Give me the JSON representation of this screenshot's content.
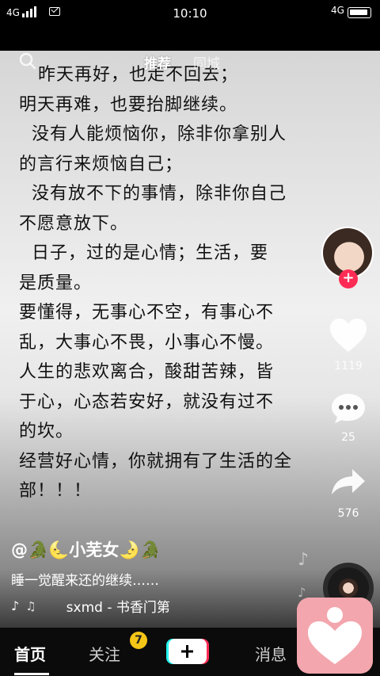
{
  "status": {
    "network_left": "4G",
    "time": "10:10",
    "network_right": "4G"
  },
  "top_tabs": {
    "recommend": "推荐",
    "local": "同城"
  },
  "post": {
    "lines": [
      "   昨天再好，也走不回去；",
      "明天再难，也要抬脚继续。",
      "  没有人能烦恼你，除非你拿别人",
      "的言行来烦恼自己；",
      "  没有放不下的事情，除非你自己",
      "不愿意放下。",
      "  日子，过的是心情；生活，要",
      "是质量。",
      "要懂得，无事心不空，有事心不",
      "乱，大事心不畏，小事心不慢。",
      "人生的悲欢离合，酸甜苦辣，皆",
      "于心，心态若安好，就没有过不",
      "的坎。",
      "经营好心情，你就拥有了生活的全",
      "部！！！"
    ]
  },
  "rail": {
    "like_count": "1119",
    "comment_count": "25",
    "share_count": "576"
  },
  "info": {
    "author": "@🐊🌜小芜女🌛🐊",
    "desc": "睡一觉醒来还的继续……",
    "music": "sxmd - 书香门第"
  },
  "nav": {
    "home": "首页",
    "follow": "关注",
    "follow_badge": "7",
    "messages": "消息"
  },
  "colors": {
    "follow_red": "#fe2c55",
    "badge_yellow": "#f5c518",
    "float_pink": "#f3a6ad"
  }
}
